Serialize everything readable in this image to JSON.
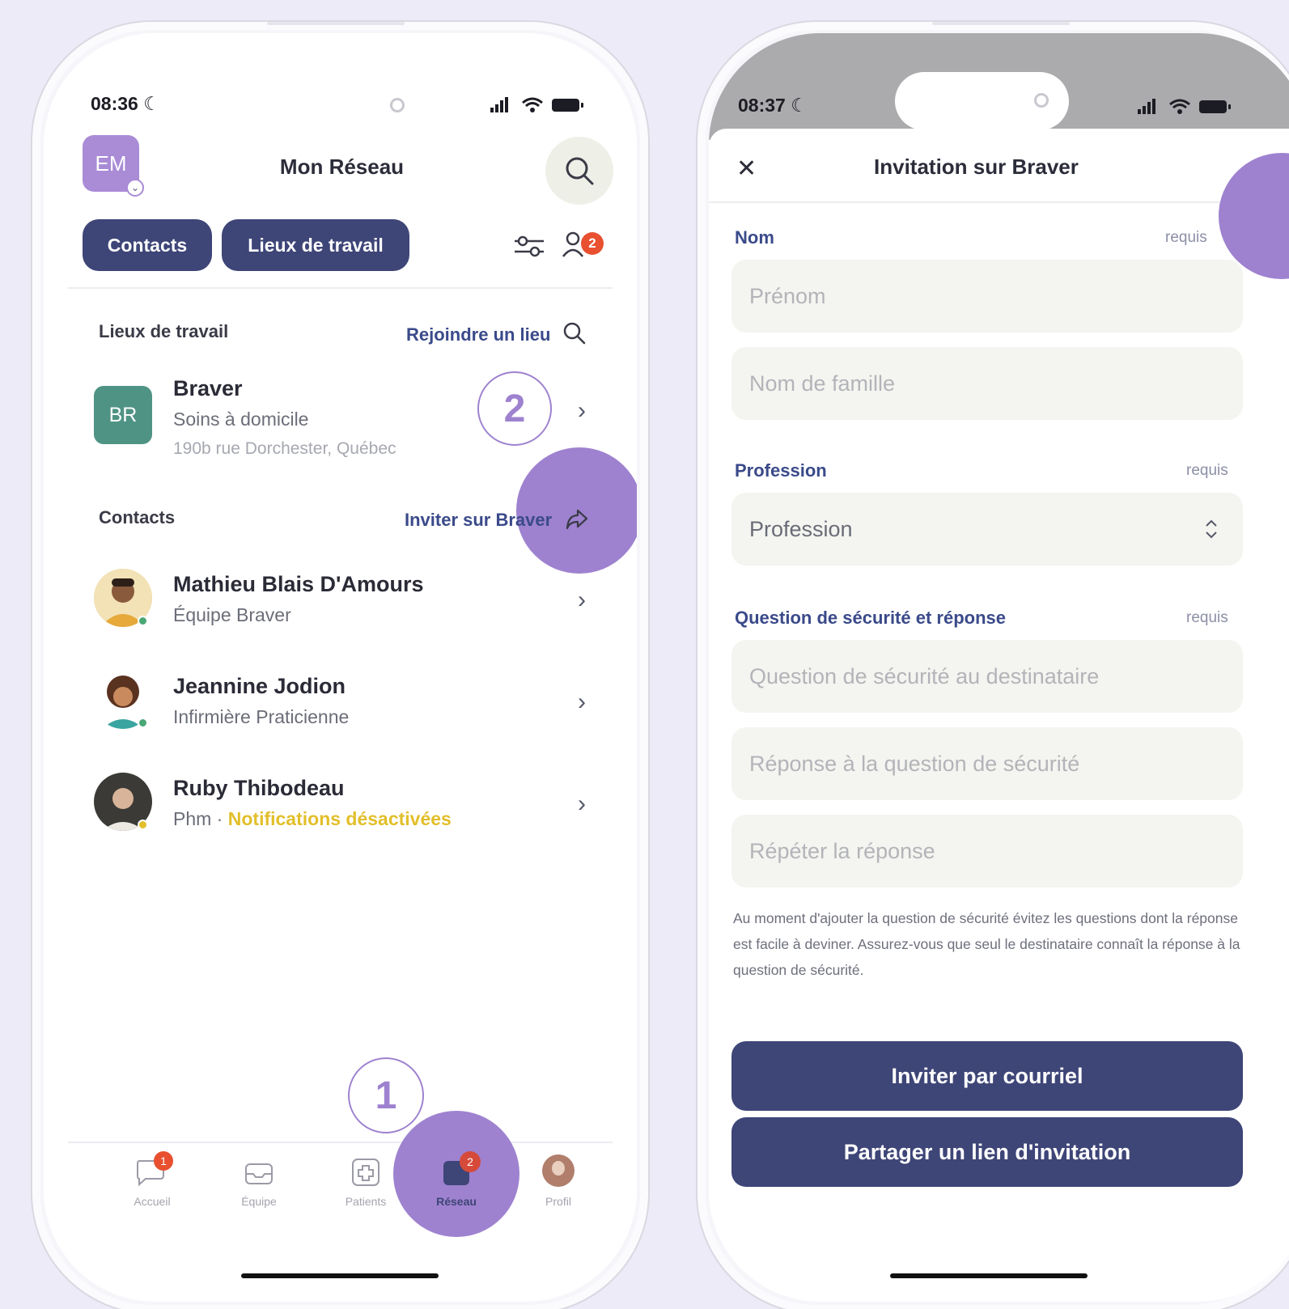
{
  "left": {
    "status": {
      "time": "08:36"
    },
    "header": {
      "avatar_initials": "EM",
      "title": "Mon Réseau"
    },
    "tabs": [
      {
        "label": "Contacts"
      },
      {
        "label": "Lieux de travail"
      }
    ],
    "requests_badge": "2",
    "workplaces": {
      "label": "Lieux de travail",
      "link": "Rejoindre un lieu",
      "items": [
        {
          "initials": "BR",
          "name": "Braver",
          "type": "Soins à domicile",
          "address": "190b rue Dorchester, Québec"
        }
      ]
    },
    "contacts": {
      "label": "Contacts",
      "link": "Inviter sur Braver",
      "items": [
        {
          "name": "Mathieu Blais D'Amours",
          "subtitle": "Équipe Braver",
          "status_color": "#4aa876"
        },
        {
          "name": "Jeannine Jodion",
          "subtitle": "Infirmière Praticienne",
          "status_color": "#4aa876"
        },
        {
          "name": "Ruby Thibodeau",
          "subtitle": "Phm",
          "separator": " · ",
          "notice": "Notifications désactivées",
          "status_color": "#e2bf2a"
        }
      ]
    },
    "steps": {
      "one": "1",
      "two": "2"
    },
    "tabbar": [
      {
        "label": "Accueil",
        "badge": "1"
      },
      {
        "label": "Équipe"
      },
      {
        "label": "Patients"
      },
      {
        "label": "Réseau",
        "badge": "2",
        "active": true
      },
      {
        "label": "Profil"
      }
    ]
  },
  "right": {
    "status": {
      "time": "08:37"
    },
    "header": {
      "title": "Invitation sur Braver"
    },
    "sections": {
      "name": {
        "label": "Nom",
        "required": "requis",
        "first_placeholder": "Prénom",
        "last_placeholder": "Nom de famille"
      },
      "profession": {
        "label": "Profession",
        "required": "requis",
        "value": "Profession"
      },
      "security": {
        "label": "Question de sécurité et réponse",
        "required": "requis",
        "question_placeholder": "Question de sécurité au destinataire",
        "answer_placeholder": "Réponse à la question de sécurité",
        "repeat_placeholder": "Répéter la réponse"
      }
    },
    "help_text": "Au moment d'ajouter la question de sécurité évitez les questions dont la réponse est facile à deviner. Assurez-vous que seul le destinataire connaît la réponse à la question de sécurité.",
    "buttons": {
      "email": "Inviter par courriel",
      "share": "Partager un lien d'invitation"
    }
  },
  "colors": {
    "accent": "#3e4577",
    "highlight": "#9e82cf",
    "warning": "#e2bf2a",
    "badge": "#e8502f"
  }
}
